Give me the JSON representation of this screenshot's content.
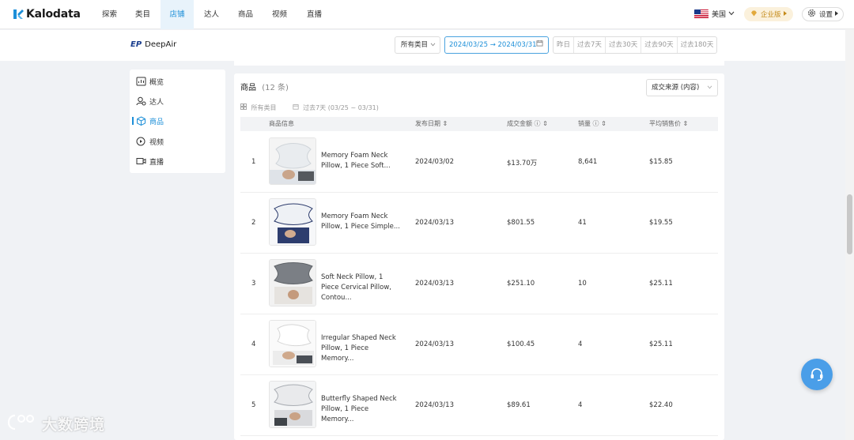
{
  "app": {
    "name": "Kalodata",
    "nav": [
      "探索",
      "类目",
      "店铺",
      "达人",
      "商品",
      "视频",
      "直播"
    ],
    "active_nav": "店铺",
    "region": "美国",
    "enterprise_label": "企业版",
    "settings_label": "设置"
  },
  "shop": {
    "name": "DeepAir",
    "logo_text": "EP",
    "category_select": "所有类目",
    "date_range": "2024/03/25 → 2024/03/31",
    "quick_dates": [
      "昨日",
      "过去7天",
      "过去30天",
      "过去90天",
      "过去180天"
    ]
  },
  "sidebar": {
    "items": [
      {
        "label": "概览",
        "icon": "overview-icon"
      },
      {
        "label": "达人",
        "icon": "creator-icon"
      },
      {
        "label": "商品",
        "icon": "product-box-icon"
      },
      {
        "label": "视频",
        "icon": "video-play-icon"
      },
      {
        "label": "直播",
        "icon": "live-camera-icon"
      }
    ],
    "active": "商品"
  },
  "products": {
    "title": "商品",
    "count_label": "(12 条)",
    "source_select": "成交来源 (内容)",
    "filter_category": "所有类目",
    "filter_date": "过去7天 (03/25 ~ 03/31)",
    "columns": [
      "商品信息",
      "发布日期",
      "成交金额",
      "销量",
      "平均销售价"
    ],
    "rows": [
      {
        "rank": "1",
        "name": "Memory Foam Neck Pillow, 1 Piece Soft...",
        "date": "2024/03/02",
        "amount": "$13.70万",
        "sales": "8,641",
        "avg": "$15.85"
      },
      {
        "rank": "2",
        "name": "Memory Foam Neck Pillow, 1 Piece Simple...",
        "date": "2024/03/13",
        "amount": "$801.55",
        "sales": "41",
        "avg": "$19.55"
      },
      {
        "rank": "3",
        "name": "Soft Neck Pillow, 1 Piece Cervical Pillow, Contou...",
        "date": "2024/03/13",
        "amount": "$251.10",
        "sales": "10",
        "avg": "$25.11"
      },
      {
        "rank": "4",
        "name": "Irregular Shaped Neck Pillow, 1 Piece Memory...",
        "date": "2024/03/13",
        "amount": "$100.45",
        "sales": "4",
        "avg": "$25.11"
      },
      {
        "rank": "5",
        "name": "Butterfly Shaped Neck Pillow, 1 Piece Memory...",
        "date": "2024/03/13",
        "amount": "$89.61",
        "sales": "4",
        "avg": "$22.40"
      }
    ]
  },
  "watermark": "大数跨境",
  "colors": {
    "accent": "#1d8fd8",
    "enterprise": "#c48a1a",
    "support": "#4a9ee8"
  }
}
